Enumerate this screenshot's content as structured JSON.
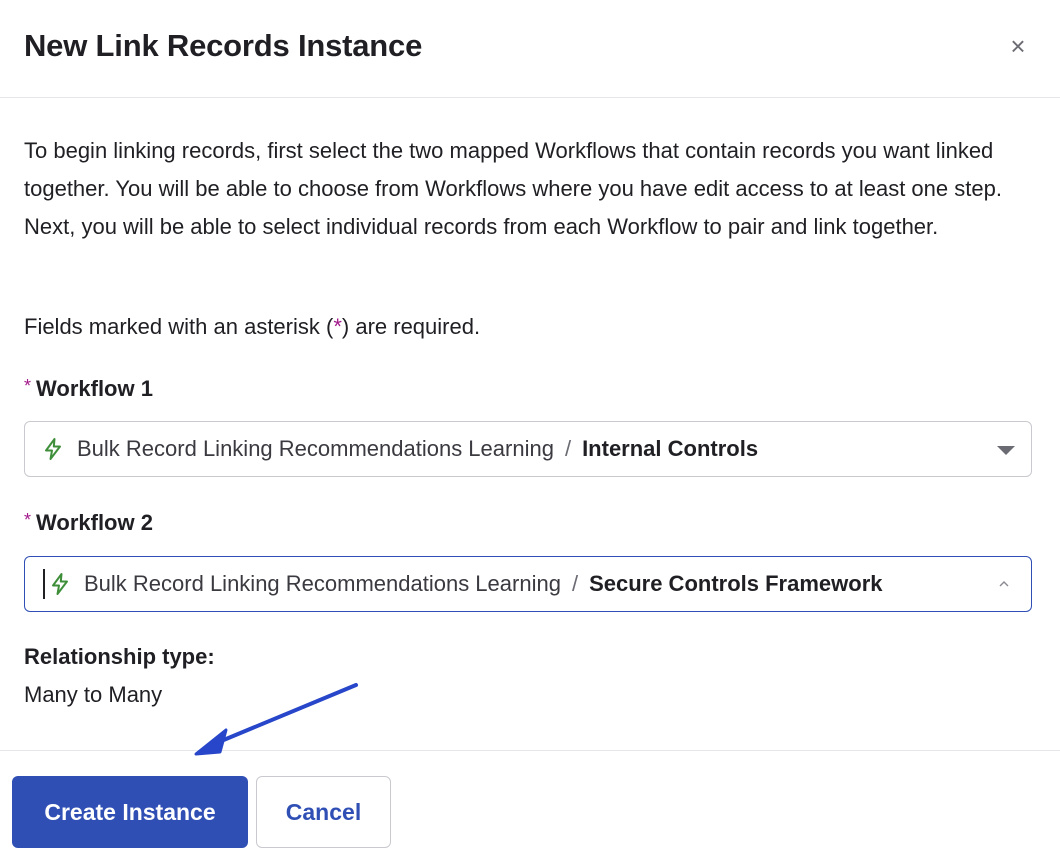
{
  "modal": {
    "title": "New Link Records Instance",
    "close_glyph": "×"
  },
  "intro": {
    "text": "To begin linking records, first select the two mapped Workflows that contain records you want linked together. You will be able to choose from Workflows where you have edit access to at least one step. Next, you will be able to select individual records from each Workflow to pair and link together."
  },
  "required_note": {
    "prefix": "Fields marked with an asterisk (",
    "star": "*",
    "suffix": ") are required."
  },
  "workflow1": {
    "star": "*",
    "label": "Workflow 1",
    "workspace": "Bulk Record Linking Recommendations Learning",
    "separator": "/",
    "workflow": "Internal Controls",
    "icon": "bolt-icon",
    "expanded": false
  },
  "workflow2": {
    "star": "*",
    "label": "Workflow 2",
    "workspace": "Bulk Record Linking Recommendations Learning",
    "separator": "/",
    "workflow": "Secure Controls Framework",
    "icon": "bolt-icon",
    "expanded": true
  },
  "relationship": {
    "label": "Relationship type:",
    "value": "Many to Many"
  },
  "footer": {
    "create_label": "Create Instance",
    "cancel_label": "Cancel"
  },
  "colors": {
    "primary": "#2f4fb5",
    "required_star": "#a3198b",
    "bolt": "#3f8f3a",
    "annotation_arrow": "#2746c9"
  }
}
